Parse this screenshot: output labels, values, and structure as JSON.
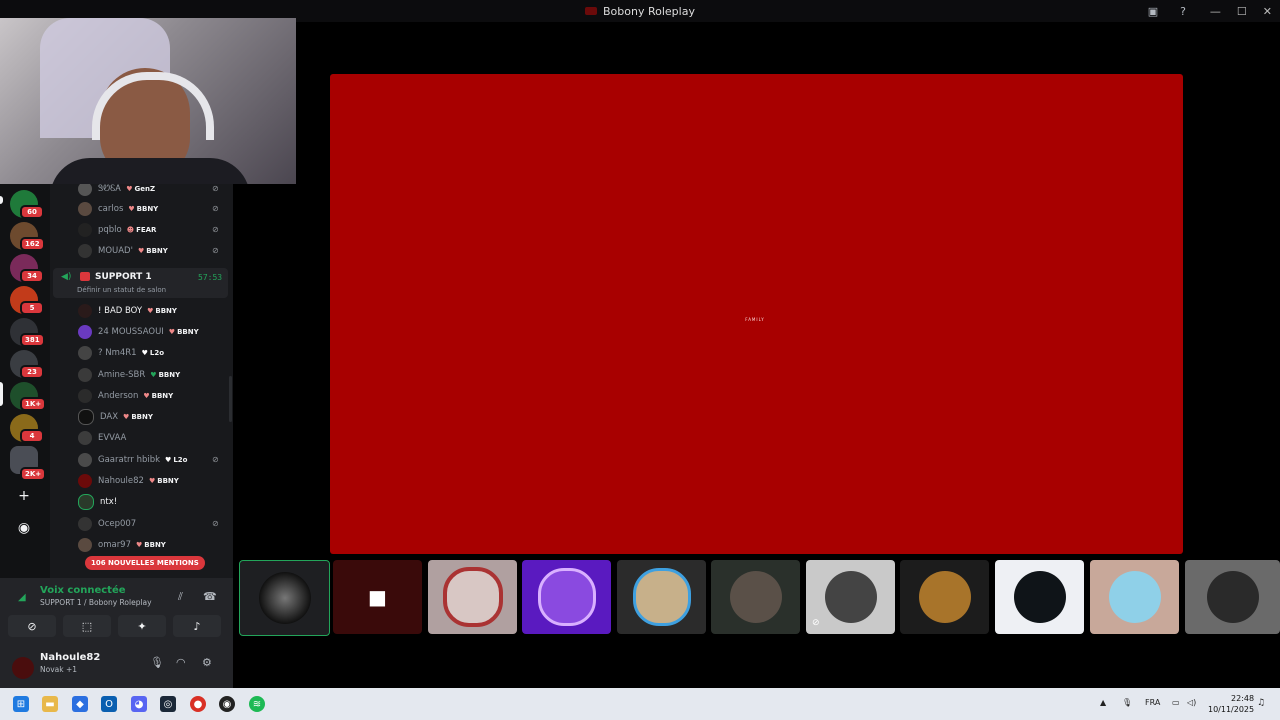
{
  "window": {
    "title": "Bobony Roleplay",
    "controls": [
      "—",
      "☐",
      "✕"
    ]
  },
  "server_badges": [
    "60",
    "162",
    "34",
    "5",
    "381",
    "23",
    "1K+",
    "4",
    "2K+"
  ],
  "top_members": [
    {
      "name": "ᏕᏬᏋᎪ",
      "tag": "GenZ",
      "muted": true
    },
    {
      "name": "carlos",
      "tag": "BBNY",
      "muted": true
    },
    {
      "name": "pqblo",
      "tag": "FEAR",
      "muted": true
    },
    {
      "name": "MOUAD'",
      "tag": "BBNY",
      "muted": true
    }
  ],
  "voice_channel": {
    "name": "SUPPORT 1",
    "time": "57:53",
    "status": "Définir un statut de salon"
  },
  "members": [
    {
      "name": "! BAD BOY",
      "tag": "BBNY",
      "active": true,
      "muted": false
    },
    {
      "name": "24 MOUSSAOUI",
      "tag": "BBNY",
      "active": false,
      "muted": false
    },
    {
      "name": "? Nm4R1",
      "tag": "L2o",
      "active": false,
      "muted": false
    },
    {
      "name": "Amine-SBR",
      "tag": "BBNY",
      "active": false,
      "muted": false
    },
    {
      "name": "Anderson",
      "tag": "BBNY",
      "active": false,
      "muted": false
    },
    {
      "name": "DAX",
      "tag": "BBNY",
      "active": false,
      "muted": false
    },
    {
      "name": "EVVAA",
      "tag": "",
      "active": false,
      "muted": false
    },
    {
      "name": "Gaaratrr hbibk",
      "tag": "L2o",
      "active": false,
      "muted": true
    },
    {
      "name": "Nahoule82",
      "tag": "BBNY",
      "active": false,
      "muted": false
    },
    {
      "name": "ntx!",
      "tag": "",
      "active": true,
      "muted": false
    },
    {
      "name": "Ocep007",
      "tag": "",
      "active": false,
      "muted": true
    },
    {
      "name": "omar97",
      "tag": "BBNY",
      "active": false,
      "muted": false
    }
  ],
  "mentions_label": "106 NOUVELLES MENTIONS",
  "voice_panel": {
    "title": "Voix connectée",
    "subtitle": "SUPPORT 1 / Bobony Roleplay"
  },
  "user": {
    "name": "Nahoule82",
    "status": "Novak +1"
  },
  "stage_logo": "FAMILY",
  "taskbar": {
    "lang": "FRA",
    "time": "22:48",
    "date": "10/11/2025"
  }
}
